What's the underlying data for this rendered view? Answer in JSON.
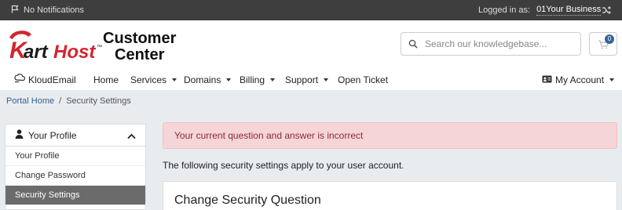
{
  "topbar": {
    "notifications": "No Notifications",
    "logged_in_as": "Logged in as:",
    "account_name": "01Your Business"
  },
  "logo": {
    "brand": "KartHost",
    "tm": "™",
    "title_line1": "Customer",
    "title_line2": "Center"
  },
  "search": {
    "placeholder": "Search our knowledgebase..."
  },
  "cart": {
    "count": "0"
  },
  "nav": {
    "items": [
      {
        "label": "KloudEmail"
      },
      {
        "label": "Home"
      },
      {
        "label": "Services"
      },
      {
        "label": "Domains"
      },
      {
        "label": "Billing"
      },
      {
        "label": "Support"
      },
      {
        "label": "Open Ticket"
      }
    ],
    "account": "My Account"
  },
  "breadcrumb": {
    "home": "Portal Home",
    "separator": "/",
    "current": "Security Settings"
  },
  "sidebar": {
    "title": "Your Profile",
    "items": [
      {
        "label": "Your Profile"
      },
      {
        "label": "Change Password"
      },
      {
        "label": "Security Settings"
      }
    ]
  },
  "main": {
    "alert": "Your current question and answer is incorrect",
    "intro": "The following security settings apply to your user account.",
    "card_title": "Change Security Question"
  },
  "colors": {
    "topbar": "#3e3e3e",
    "brand_red": "#d22630",
    "alert_bg": "#f5d5d8",
    "active_sidebar": "#6b6b6b"
  }
}
